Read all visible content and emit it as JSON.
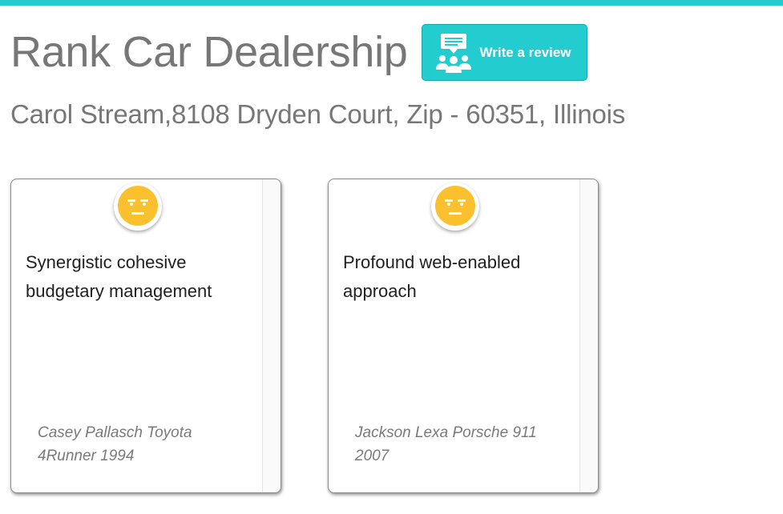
{
  "page": {
    "accent_color": "#22cccf",
    "text_gray": "#777777"
  },
  "dealer": {
    "name": "Rank Car Dealership",
    "address": "Carol Stream,8108 Dryden Court, Zip - 60351, Illinois"
  },
  "write_review": {
    "label": "Write a review",
    "icon": "review-people-icon"
  },
  "reviews": [
    {
      "title": "Synergistic cohesive budgetary management",
      "author": "Casey Pallasch Toyota 4Runner 1994",
      "rating_icon": "neutral-face-icon"
    },
    {
      "title": "Profound web-enabled approach",
      "author": "Jackson Lexa Porsche 911 2007",
      "rating_icon": "neutral-face-icon"
    }
  ]
}
